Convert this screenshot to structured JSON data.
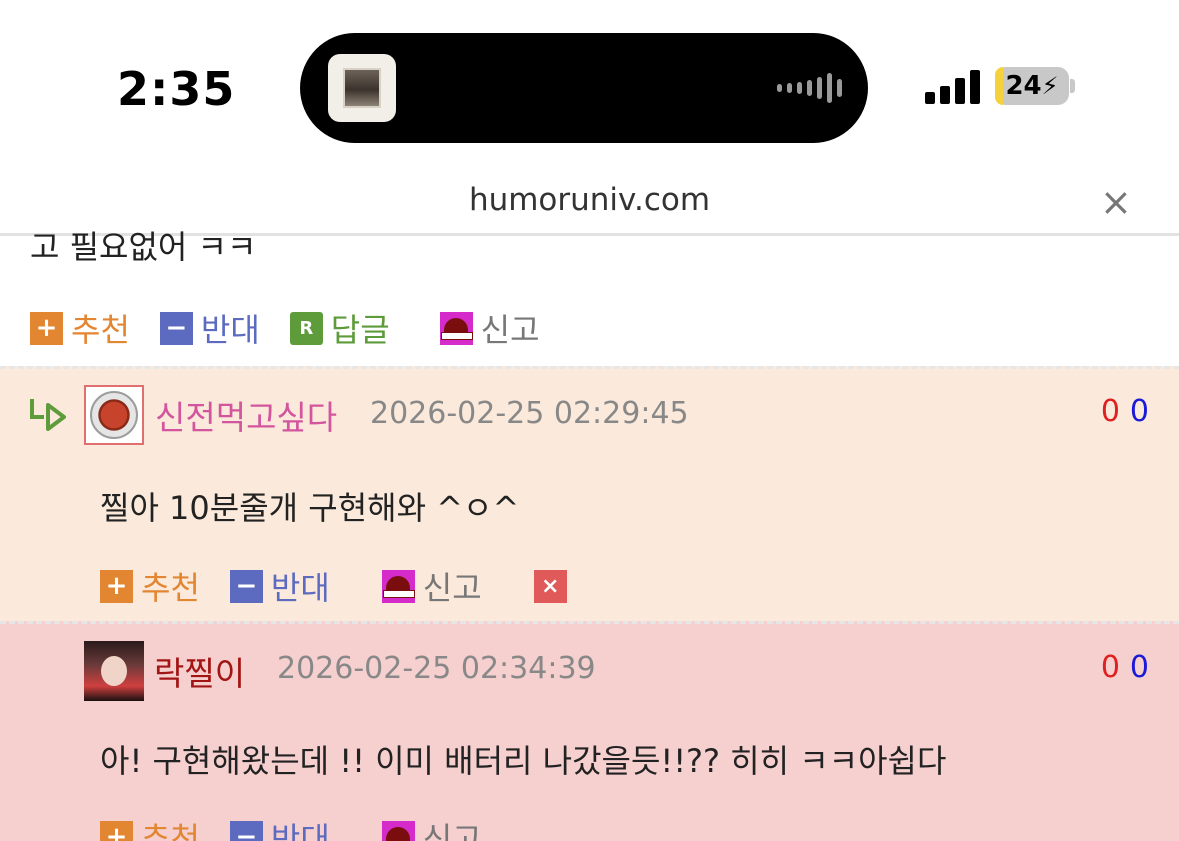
{
  "status_bar": {
    "time": "2:35",
    "battery": "24"
  },
  "browser": {
    "url": "humoruniv.com",
    "close_label": "×"
  },
  "partial_comment_text": "고 필요없어 ㅋㅋ",
  "action_labels": {
    "recommend": "추천",
    "oppose": "반대",
    "reply": "답글",
    "report": "신고",
    "reply_icon": "R",
    "delete_icon": "×"
  },
  "comments": [
    {
      "nickname": "신전먹고싶다",
      "datetime": "2026-02-25 02:29:45",
      "text": "찔아 10분줄개 구현해와 ^ㅇ^",
      "up_votes": "0",
      "down_votes": "0",
      "avatar": "tteokbokki-avatar"
    },
    {
      "nickname": "락찔이",
      "datetime": "2026-02-25 02:34:39",
      "text": "아! 구현해왔는데 !! 이미 배터리 나갔을듯!!?? 히히 ㅋㅋ아쉽다",
      "up_votes": "0",
      "down_votes": "0",
      "avatar": "portrait-avatar"
    }
  ],
  "colors": {
    "comment_bg_reply": "#fbeadb",
    "comment_bg_author": "#f6cfcf",
    "recommend": "#e38632",
    "oppose": "#5c6bc0",
    "reply": "#5e9b3b",
    "report_icon": "#d62bcb",
    "delete_icon": "#e05a5a",
    "nick_reply": "#d2559e",
    "nick_author": "#a21515"
  }
}
